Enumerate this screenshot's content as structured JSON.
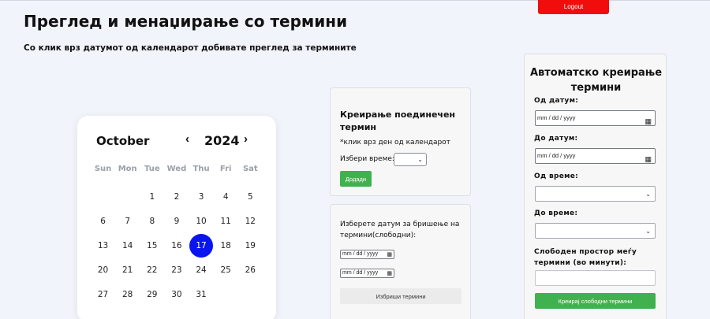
{
  "header": {
    "logout_label": "Logout",
    "title": "Преглед и менаџирање со термини",
    "subtitle": "Со клик врз датумот од календарот добивате преглед за термините"
  },
  "calendar": {
    "month": "October",
    "year": "2024",
    "prev_icon": "chevron-left-icon",
    "next_icon": "chevron-right-icon",
    "weekdays": [
      "Sun",
      "Mon",
      "Tue",
      "Wed",
      "Thu",
      "Fri",
      "Sat"
    ],
    "weeks": [
      [
        "",
        "",
        "1",
        "2",
        "3",
        "4",
        "5"
      ],
      [
        "6",
        "7",
        "8",
        "9",
        "10",
        "11",
        "12"
      ],
      [
        "13",
        "14",
        "15",
        "16",
        "17",
        "18",
        "19"
      ],
      [
        "20",
        "21",
        "22",
        "23",
        "24",
        "25",
        "26"
      ],
      [
        "27",
        "28",
        "29",
        "30",
        "31",
        "",
        ""
      ]
    ],
    "selected_day": "17",
    "selected_color": "#0a14f0"
  },
  "create_single": {
    "title": "Креирање поединечен термин",
    "hint": "*клик врз ден од календарот",
    "time_label": "Избери време:",
    "time_value": "",
    "add_label": "Додади"
  },
  "delete_range": {
    "title": "Изберете датум за бришење на термини(слободни):",
    "date_placeholder": "mm / dd / yyyy",
    "delete_label": "Избриши термини"
  },
  "auto_create": {
    "title": "Автоматско креирање термини",
    "from_date_label": "Од датум:",
    "to_date_label": "До датум:",
    "date_placeholder": "mm / dd / yyyy",
    "from_time_label": "Од време:",
    "to_time_label": "До време:",
    "gap_label": "Слободен простор меѓу термини (во минути):",
    "create_label": "Креирај слободни термини"
  },
  "colors": {
    "logout": "#f20d0d",
    "primary_green": "#3fb24f",
    "selected_day": "#0a14f0"
  }
}
